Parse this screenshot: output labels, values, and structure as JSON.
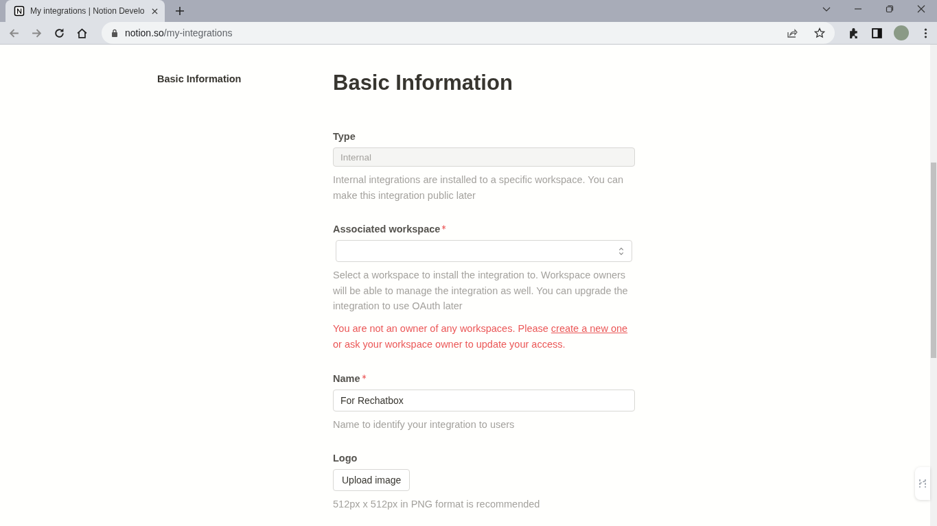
{
  "browser": {
    "tab_title": "My integrations | Notion Develo",
    "url_host": "notion.so",
    "url_path": "/my-integrations"
  },
  "sidebar": {
    "items": [
      {
        "label": "Basic Information",
        "selected": true
      }
    ]
  },
  "heading": "Basic Information",
  "fields": [
    {
      "kind": "readonly",
      "label": "Type",
      "required": false,
      "value": "Internal",
      "hint": "Internal integrations are installed to a specific workspace. You can make this integration public later"
    },
    {
      "kind": "select",
      "label": "Associated workspace",
      "required": true,
      "hint": "Select a workspace to install the integration to. Workspace owners will be able to manage the integration as well. You can upgrade the integration to use OAuth later",
      "error": {
        "before": "You are not an owner of any workspaces. Please ",
        "link": "create a new one",
        "after": " or ask your workspace owner to update your access."
      }
    },
    {
      "kind": "text",
      "label": "Name",
      "required": true,
      "value": "For Rechatbox",
      "hint": "Name to identify your integration to users"
    },
    {
      "kind": "upload",
      "label": "Logo",
      "required": false,
      "button": "Upload image",
      "hint": "512px x 512px in PNG format is recommended"
    }
  ]
}
